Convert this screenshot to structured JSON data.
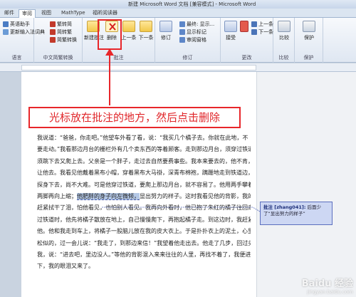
{
  "window": {
    "title": "新建 Microsoft Word 文档 [兼容模式] - Microsoft Word"
  },
  "tabs": [
    "邮件",
    "审阅",
    "视图",
    "MathType",
    "福昕阅读器"
  ],
  "active_tab": "审阅",
  "ribbon": {
    "proofing": {
      "label": "语言",
      "b1": "英语助手",
      "b2": "更新输入法词典"
    },
    "chinese": {
      "label": "中文简繁转换",
      "b1": "繁转简",
      "b2": "简转繁",
      "b3": "简繁转换"
    },
    "comments": {
      "label": "批注",
      "new": "新建批注",
      "delete": "删除",
      "prev": "上一条",
      "next": "下一条"
    },
    "tracking": {
      "label": "修订",
      "track": "修订",
      "display": "最终: 显示...",
      "show_markup": "显示标记",
      "pane": "审阅窗格"
    },
    "changes": {
      "label": "更改",
      "accept": "接受",
      "reject": "拒绝",
      "prev": "上一条",
      "next": "下一条"
    },
    "compare": {
      "label": "比较",
      "btn": "比较"
    },
    "protect": {
      "label": "保护",
      "btn": "保护"
    }
  },
  "annotation": "光标放在批注的地方，然后点击删除",
  "document": {
    "lines": [
      "我说道：“爸爸，你走吧。”他望车外看了看，说：“我买几个橘子去。你就在此地，不",
      "要走动。”我看那边月台的栅栏外有几个卖东西的等着顾客。走到那边月台，须穿过铁道，",
      "须跳下去又爬上去。父亲是一个胖子，走过去自然要费事些。我本来要去的，他不肯，只好",
      "让他去。我看见他戴着黑布小帽，穿着黑布大马褂，深青布棉袍，蹒跚地走到铁道边，慢慢",
      "探身下去，尚不大难。可是他穿过铁道，要爬上那边月台，就不容易了。他用两手攀着上面，",
      "两脚再向上缩；",
      "他肥胖的身子向左微倾，",
      "显出努力的样子。这时我看见他的背影，我的泪很快地流下来了。我",
      "赶紧拭干了泪，怕他看见，也怕别人看见。我再向外看时，他已抱了朱红的橘子往回走了。",
      "过铁道时，他先将橘子散放在地上，自己慢慢爬下，再抱起橘子走。到这边时，我赶紧去搀",
      "他。他和我走到车上，将橘子一股脑儿放在我的皮大衣上。于是扑扑衣上的泥土，心里很轻",
      "松似的，过一会儿说：“我走了，到那边来信！”我望着他走出去。他走了几步，回过头看见",
      "我，说：“进去吧，里边没人。”等他的背影混入来来往往的人里，再找不着了，我便进来坐",
      "下，我的眼泪又来了。"
    ]
  },
  "comment": {
    "author": "批注 [zhang041]:",
    "text": "后面少了“显出努力的样子”"
  },
  "watermark": {
    "main": "Baidu 经验",
    "sub": "jingyan.baidu.com"
  }
}
